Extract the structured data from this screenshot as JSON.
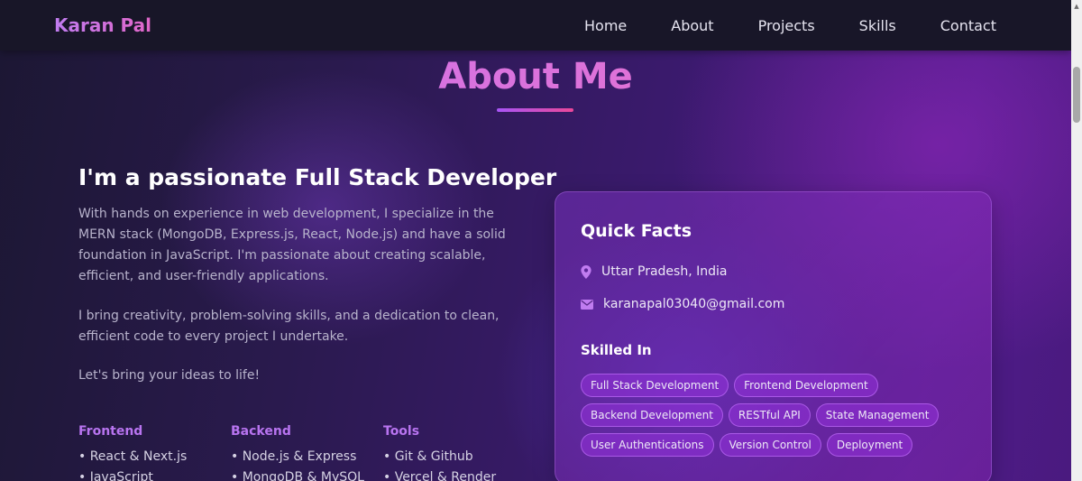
{
  "nav": {
    "brand": "Karan Pal",
    "links": [
      "Home",
      "About",
      "Projects",
      "Skills",
      "Contact"
    ]
  },
  "about": {
    "title": "About Me",
    "heading": "I'm a passionate Full Stack Developer",
    "paragraphs": [
      "With hands on experience in web development, I specialize in the MERN stack (MongoDB, Express.js, React, Node.js) and have a solid foundation in JavaScript. I'm passionate about creating scalable, efficient, and user-friendly applications.",
      "I bring creativity, problem-solving skills, and a dedication to clean, efficient code to every project I undertake.",
      "Let's bring your ideas to life!"
    ],
    "skill_columns": [
      {
        "title": "Frontend",
        "items": [
          "• React & Next.js",
          "• JavaScript"
        ]
      },
      {
        "title": "Backend",
        "items": [
          "• Node.js & Express",
          "• MongoDB & MySQL"
        ]
      },
      {
        "title": "Tools",
        "items": [
          "• Git & Github",
          "• Vercel & Render"
        ]
      }
    ]
  },
  "quick_facts": {
    "title": "Quick Facts",
    "location": "Uttar Pradesh, India",
    "email": "karanapal03040@gmail.com",
    "skilled_title": "Skilled In",
    "tags": [
      "Full Stack Development",
      "Frontend Development",
      "Backend Development",
      "RESTful API",
      "State Management",
      "User Authentications",
      "Version Control",
      "Deployment"
    ]
  },
  "icons": {
    "location": "map-pin-icon",
    "email": "envelope-icon",
    "scroll_up": "triangle-up-icon"
  },
  "colors": {
    "accent_purple": "#a855f7",
    "accent_pink": "#ec4899",
    "nav_bg": "#181628"
  }
}
